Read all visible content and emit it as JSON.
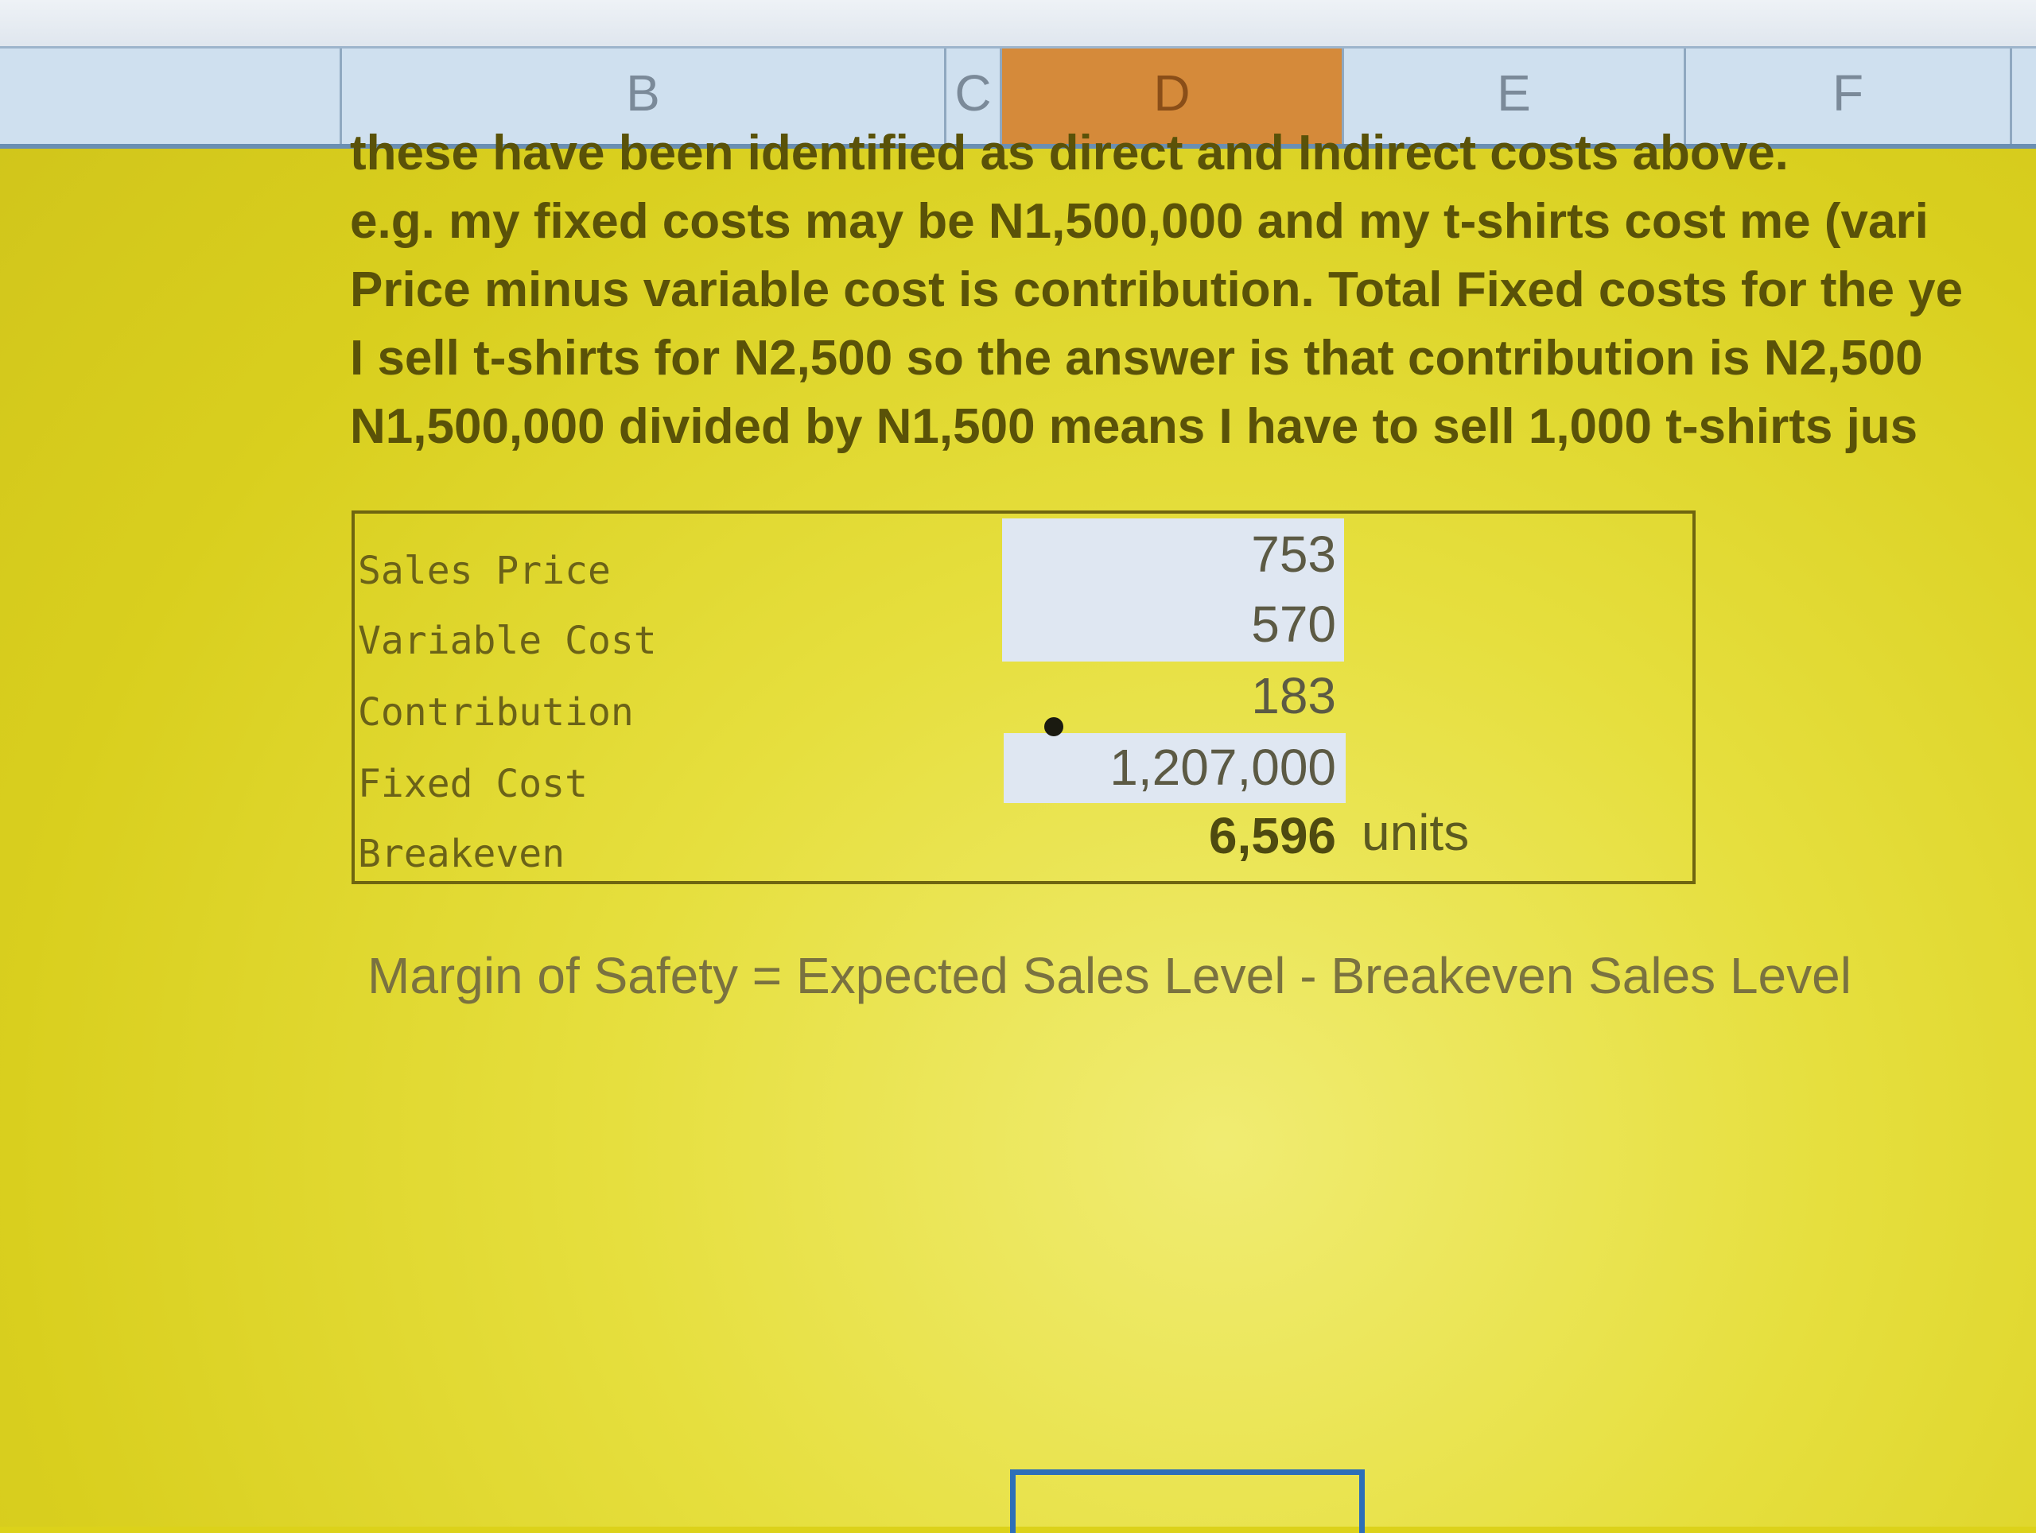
{
  "columns": [
    {
      "letter": "B"
    },
    {
      "letter": "C"
    },
    {
      "letter": "D"
    },
    {
      "letter": "E"
    },
    {
      "letter": "F"
    }
  ],
  "selected_column": "D",
  "paragraph": [
    "these have been identified as direct and Indirect costs above.",
    "e.g. my fixed costs may be N1,500,000 and my t-shirts cost me (vari",
    "Price minus variable cost is contribution.  Total Fixed costs for the ye",
    "I sell t-shirts for N2,500 so the answer is that contribution is N2,500",
    "N1,500,000 divided by N1,500 means I have to sell 1,000 t-shirts jus"
  ],
  "calc": {
    "sales_price_label": "Sales Price",
    "sales_price_value": "753",
    "variable_cost_label": "Variable Cost",
    "variable_cost_value": "570",
    "contribution_label": "Contribution",
    "contribution_value": "183",
    "fixed_cost_label": "Fixed Cost",
    "fixed_cost_value": "1,207,000",
    "breakeven_label": "Breakeven",
    "breakeven_value": "6,596",
    "breakeven_unit": "units"
  },
  "margin_of_safety_text": "Margin of Safety = Expected Sales Level - Breakeven Sales Level",
  "colors": {
    "sheet_background": "#dcd21a",
    "selected_header": "#d58a3a",
    "input_cell": "#dfe7f2",
    "active_cell_border": "#2d6fb8"
  }
}
